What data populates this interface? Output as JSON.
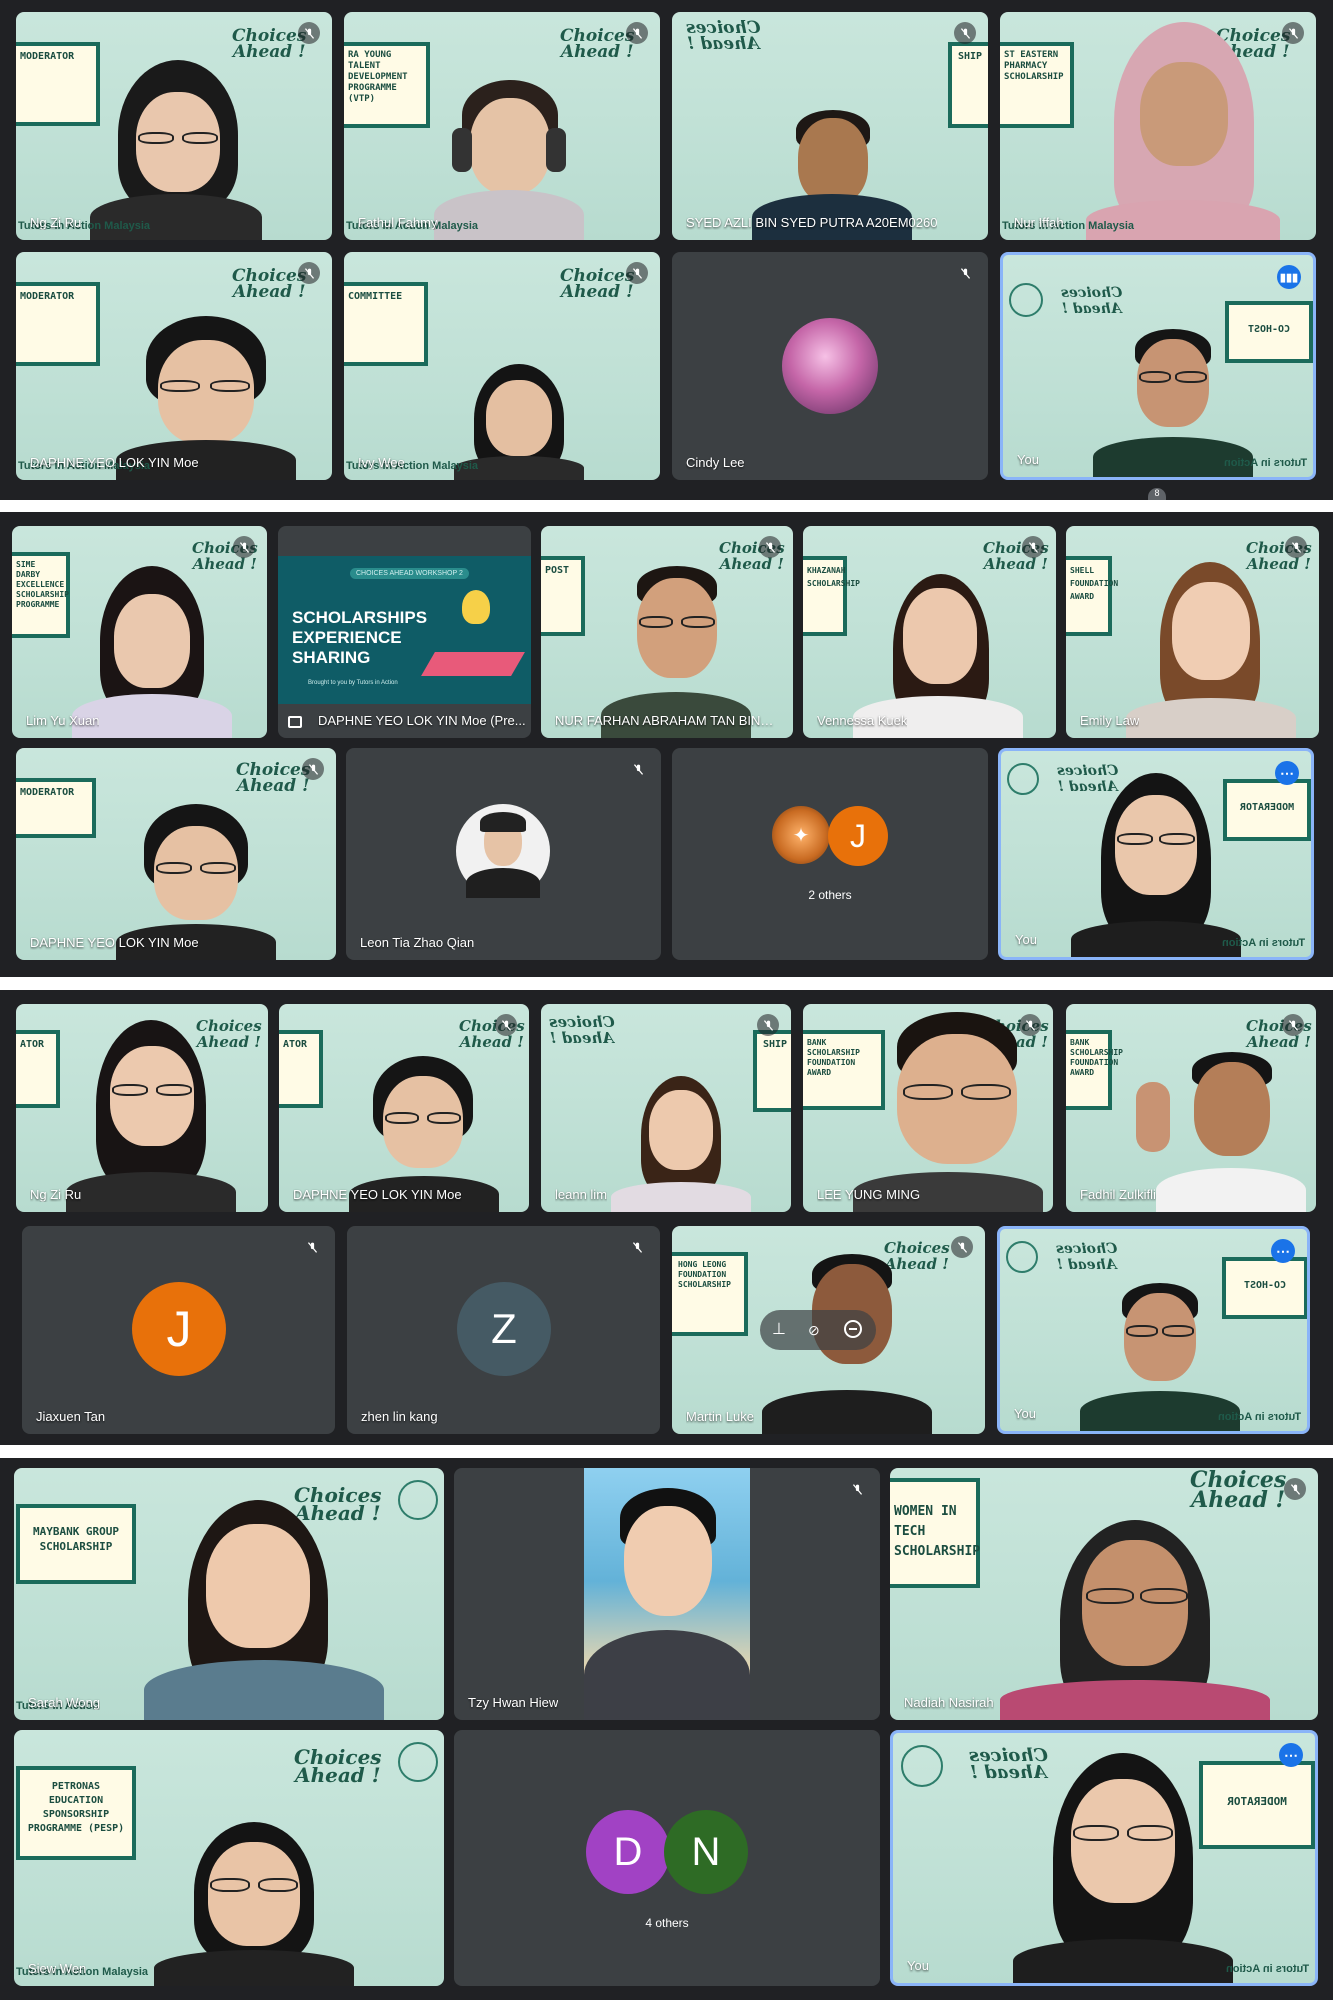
{
  "app": {
    "name": "Google Meet"
  },
  "brand": {
    "line1": "Choices",
    "line2": "Ahead !",
    "org": "Tutors in Action",
    "org_full": "Tutors in Action Malaysia"
  },
  "self_label": "You",
  "panel1": {
    "tiles": [
      {
        "name": "Ng Zi Ru",
        "sign": "MODERATOR"
      },
      {
        "name": "Fathul Fahmy",
        "sign": "RA YOUNG TALENT DEVELOPMENT PROGRAMME (VTP)"
      },
      {
        "name": "SYED AZLI BIN SYED PUTRA A20EM0260",
        "sign": "SHIP"
      },
      {
        "name": "Nur Iffah",
        "sign": "ST EASTERN PHARMACY SCHOLARSHIP"
      },
      {
        "name": "DAPHNE YEO LOK YIN Moe",
        "sign": "MODERATOR"
      },
      {
        "name": "Ivy Wee",
        "sign": "COMMITTEE"
      },
      {
        "name": "Cindy Lee"
      },
      {
        "name": "You",
        "sign": "CO-HOST"
      }
    ],
    "count": "8"
  },
  "panel2": {
    "tiles": [
      {
        "name": "Lim Yu Xuan",
        "sign": "SIME DARBY EXCELLENCE SCHOLARSHIP PROGRAMME"
      },
      {
        "name": "DAPHNE YEO LOK YIN Moe (Pre...",
        "slide_tag": "CHOICES AHEAD WORKSHOP 2",
        "slide_title": "SCHOLARSHIPS EXPERIENCE SHARING",
        "slide_footer": "Brought to you by Tutors in Action"
      },
      {
        "name": "NUR FARHAN ABRAHAM TAN BIN MU...",
        "sign": "POST"
      },
      {
        "name": "Vennessa Kuek",
        "sign": "KHAZANAH SCHOLARSHIP"
      },
      {
        "name": "Emily Law",
        "sign": "SHELL FOUNDATION AWARD"
      },
      {
        "name": "DAPHNE YEO LOK YIN Moe",
        "sign": "MODERATOR"
      },
      {
        "name": "Leon Tia Zhao Qian"
      },
      {
        "name": "2 others",
        "avatar": "J"
      },
      {
        "name": "You",
        "sign": "MODERATOR"
      }
    ]
  },
  "panel3": {
    "tiles": [
      {
        "name": "Ng Zi Ru",
        "sign": "ATOR"
      },
      {
        "name": "DAPHNE YEO LOK YIN Moe",
        "sign": "ATOR"
      },
      {
        "name": "leann lim",
        "sign": "SHIP"
      },
      {
        "name": "LEE YUNG MING",
        "sign": "BANK SCHOLARSHIP FOUNDATION AWARD"
      },
      {
        "name": "Fadhil Zulkifli",
        "sign": "BANK SCHOLARSHIP FOUNDATION AWARD"
      },
      {
        "name": "Jiaxuen Tan",
        "avatar": "J"
      },
      {
        "name": "zhen lin kang",
        "avatar": "Z"
      },
      {
        "name": "Martin Luke",
        "sign": "HONG LEONG FOUNDATION SCHOLARSHIP"
      },
      {
        "name": "You",
        "sign": "CO-HOST"
      }
    ]
  },
  "panel4": {
    "tiles": [
      {
        "name": "Sarah Wong",
        "sign": "MAYBANK GROUP SCHOLARSHIP"
      },
      {
        "name": "Tzy Hwan Hiew"
      },
      {
        "name": "Nadiah Nasirah",
        "sign": "WOMEN IN TECH SCHOLARSHIP"
      },
      {
        "name": "Siew Wen",
        "sign": "PETRONAS EDUCATION SPONSORSHIP PROGRAMME (PESP)"
      },
      {
        "name": "4 others",
        "avatars": [
          "D",
          "N"
        ]
      },
      {
        "name": "You",
        "sign": "MODERATOR"
      }
    ]
  },
  "colors": {
    "panel_bg": "#202124",
    "tile_dark": "#3c4043",
    "self_border": "#8ab4f8",
    "accent": "#1a73e8",
    "bg_tile": "#c9e6dc"
  }
}
